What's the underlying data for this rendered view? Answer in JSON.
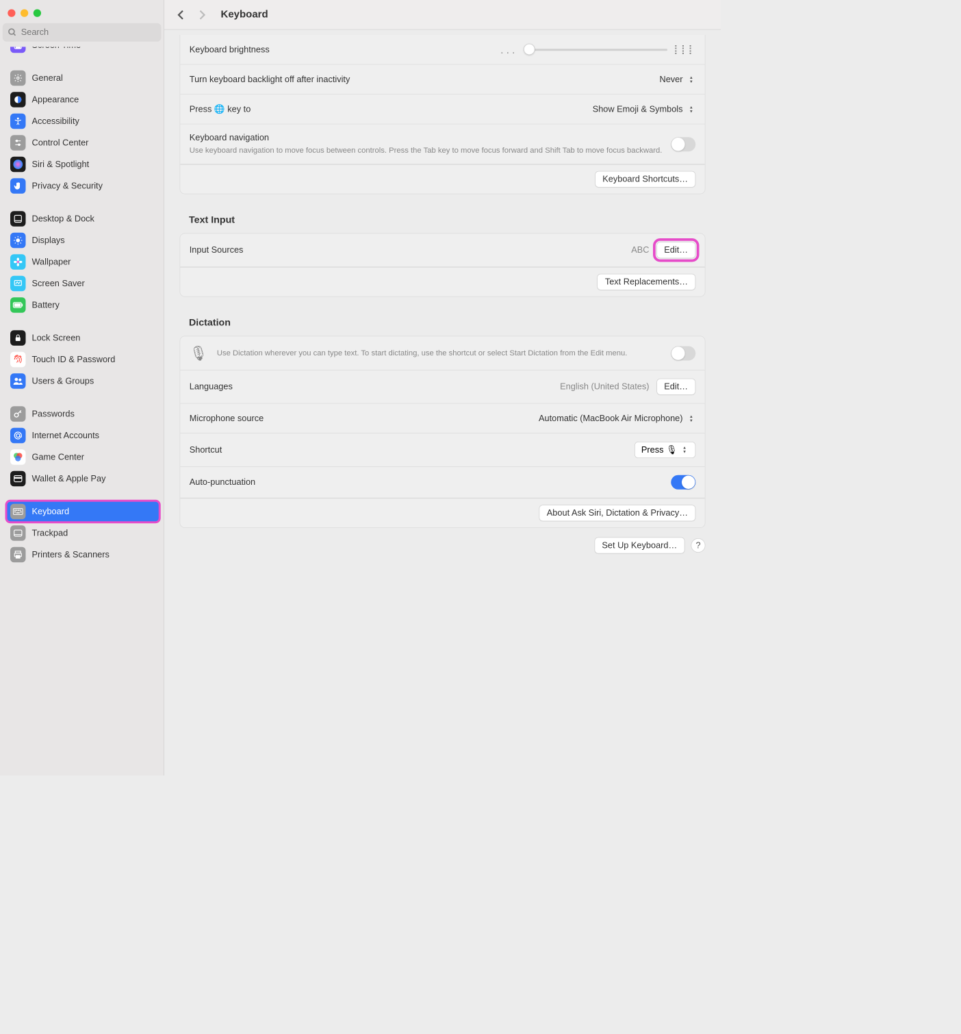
{
  "header": {
    "title": "Keyboard"
  },
  "search": {
    "placeholder": "Search"
  },
  "sidebar": {
    "cut_item": {
      "label": "Screen Time"
    },
    "groups": [
      [
        {
          "label": "General",
          "bg": "#9c9c9c",
          "icon": "gear"
        },
        {
          "label": "Appearance",
          "bg": "#1d1d1d",
          "icon": "appearance"
        },
        {
          "label": "Accessibility",
          "bg": "#3478f6",
          "icon": "accessibility"
        },
        {
          "label": "Control Center",
          "bg": "#9c9c9c",
          "icon": "controls"
        },
        {
          "label": "Siri & Spotlight",
          "bg": "#1d1d1d",
          "icon": "siri"
        },
        {
          "label": "Privacy & Security",
          "bg": "#3478f6",
          "icon": "hand"
        }
      ],
      [
        {
          "label": "Desktop & Dock",
          "bg": "#1d1d1d",
          "icon": "dock"
        },
        {
          "label": "Displays",
          "bg": "#3478f6",
          "icon": "sun"
        },
        {
          "label": "Wallpaper",
          "bg": "#34c7f6",
          "icon": "flower"
        },
        {
          "label": "Screen Saver",
          "bg": "#34c7f6",
          "icon": "screensaver"
        },
        {
          "label": "Battery",
          "bg": "#34c759",
          "icon": "battery"
        }
      ],
      [
        {
          "label": "Lock Screen",
          "bg": "#1d1d1d",
          "icon": "lock"
        },
        {
          "label": "Touch ID & Password",
          "bg": "#fff",
          "icon": "fingerprint",
          "fg": "#ff3b30"
        },
        {
          "label": "Users & Groups",
          "bg": "#3478f6",
          "icon": "users"
        }
      ],
      [
        {
          "label": "Passwords",
          "bg": "#9c9c9c",
          "icon": "key"
        },
        {
          "label": "Internet Accounts",
          "bg": "#3478f6",
          "icon": "at"
        },
        {
          "label": "Game Center",
          "bg": "#fff",
          "icon": "gamecenter"
        },
        {
          "label": "Wallet & Apple Pay",
          "bg": "#1d1d1d",
          "icon": "wallet"
        }
      ],
      [
        {
          "label": "Keyboard",
          "bg": "#9c9c9c",
          "icon": "keyboard",
          "selected": true,
          "highlighted": true
        },
        {
          "label": "Trackpad",
          "bg": "#9c9c9c",
          "icon": "trackpad"
        },
        {
          "label": "Printers & Scanners",
          "bg": "#9c9c9c",
          "icon": "printer"
        }
      ]
    ]
  },
  "keyboard_section": {
    "brightness_label": "Keyboard brightness",
    "backlight_label": "Turn keyboard backlight off after inactivity",
    "backlight_value": "Never",
    "press_key_label": "Press 🌐 key to",
    "press_key_value": "Show Emoji & Symbols",
    "navigation_label": "Keyboard navigation",
    "navigation_sub": "Use keyboard navigation to move focus between controls. Press the Tab key to move focus forward and Shift Tab to move focus backward.",
    "shortcuts_button": "Keyboard Shortcuts…"
  },
  "text_input": {
    "title": "Text Input",
    "input_sources_label": "Input Sources",
    "input_sources_value": "ABC",
    "edit_button": "Edit…",
    "replacements_button": "Text Replacements…"
  },
  "dictation": {
    "title": "Dictation",
    "description": "Use Dictation wherever you can type text. To start dictating, use the shortcut or select Start Dictation from the Edit menu.",
    "languages_label": "Languages",
    "languages_value": "English (United States)",
    "edit_button": "Edit…",
    "mic_label": "Microphone source",
    "mic_value": "Automatic (MacBook Air Microphone)",
    "shortcut_label": "Shortcut",
    "shortcut_value": "Press 🎙",
    "auto_punct_label": "Auto-punctuation",
    "about_button": "About Ask Siri, Dictation & Privacy…"
  },
  "footer": {
    "setup_button": "Set Up Keyboard…",
    "help": "?"
  }
}
